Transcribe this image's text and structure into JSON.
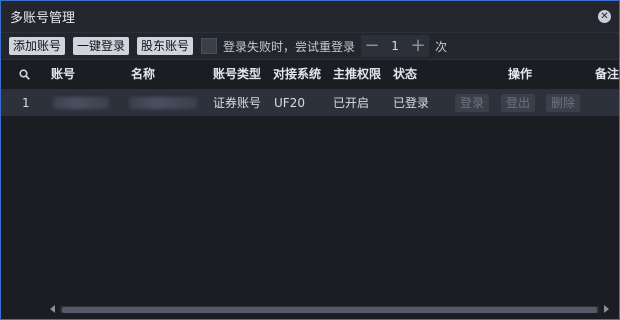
{
  "window": {
    "title": "多账号管理"
  },
  "toolbar": {
    "add_label": "添加账号",
    "login_all_label": "一键登录",
    "holder_label": "股东账号",
    "retry_label": "登录失败时，尝试重登录",
    "retry_count": "1",
    "retry_suffix": "次"
  },
  "table": {
    "columns": [
      "账号",
      "名称",
      "账号类型",
      "对接系统",
      "主推权限",
      "状态",
      "操作",
      "备注"
    ],
    "rows": [
      {
        "index": "1",
        "account_type": "证券账号",
        "system": "UF20",
        "permission": "已开启",
        "status": "已登录",
        "actions": [
          "登录",
          "登出",
          "删除"
        ]
      }
    ]
  },
  "icons": {
    "search": "search-icon",
    "close": "close-icon"
  }
}
